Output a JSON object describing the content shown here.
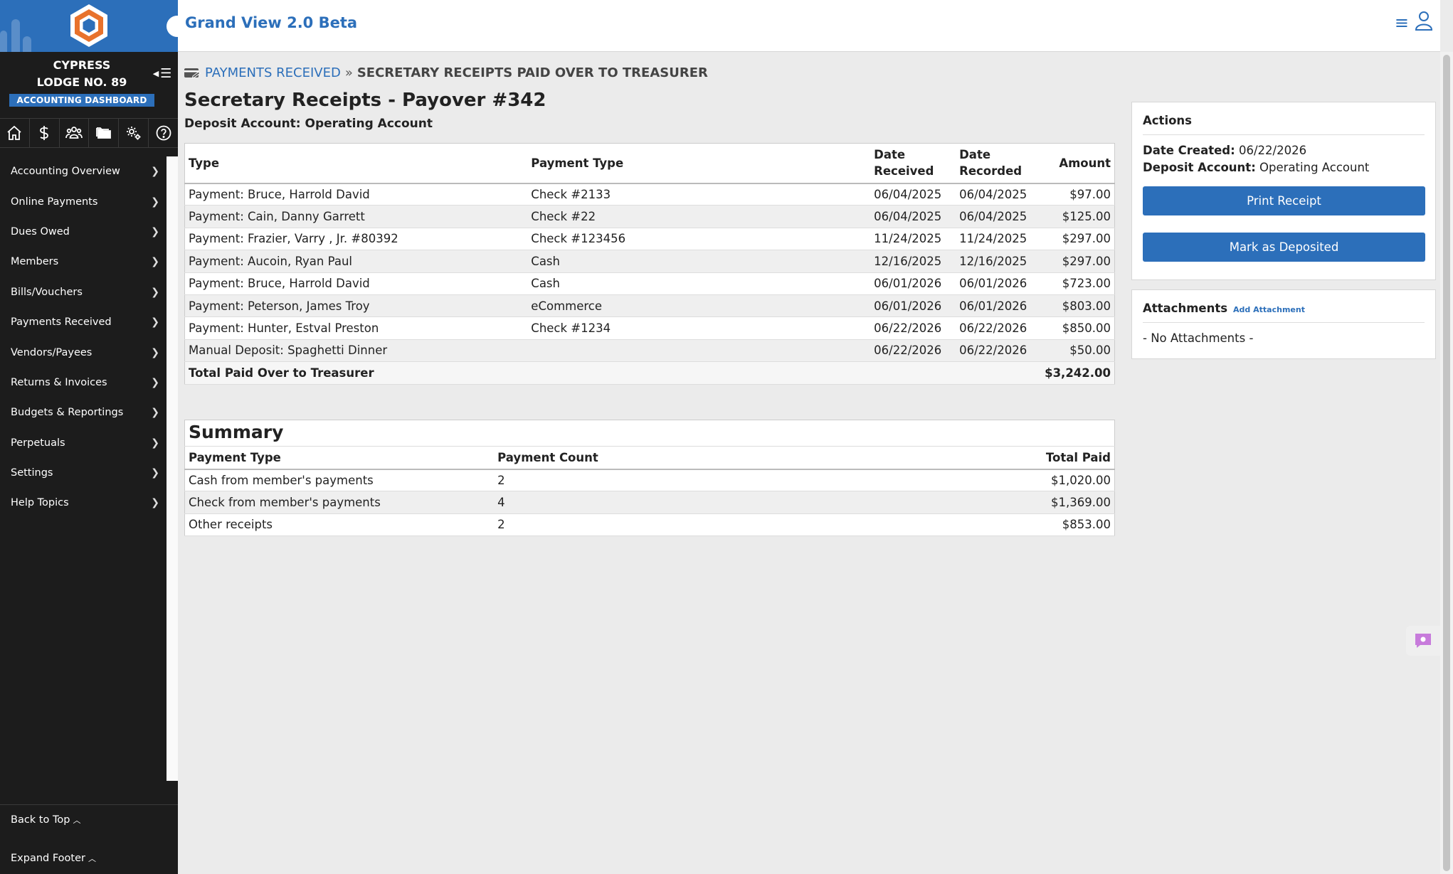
{
  "sidebar": {
    "lodge_name": "CYPRESS\nLODGE NO. 89",
    "dashboard_badge": "ACCOUNTING DASHBOARD",
    "icon_bar": [
      "home-icon",
      "dollar-icon",
      "members-icon",
      "folders-icon",
      "settings-icon",
      "help-icon"
    ],
    "items": [
      {
        "label": "Accounting Overview"
      },
      {
        "label": "Online Payments"
      },
      {
        "label": "Dues Owed"
      },
      {
        "label": "Members"
      },
      {
        "label": "Bills/Vouchers"
      },
      {
        "label": "Payments Received"
      },
      {
        "label": "Vendors/Payees"
      },
      {
        "label": "Returns & Invoices"
      },
      {
        "label": "Budgets & Reportings"
      },
      {
        "label": "Perpetuals"
      },
      {
        "label": "Settings"
      },
      {
        "label": "Help Topics"
      }
    ],
    "footer": {
      "back_to_top": "Back to Top",
      "expand_footer": "Expand Footer"
    }
  },
  "header": {
    "app_title": "Grand View 2.0 Beta"
  },
  "breadcrumb": {
    "link": "PAYMENTS RECEIVED",
    "separator": "»",
    "current": "SECRETARY RECEIPTS PAID OVER TO TREASURER"
  },
  "main": {
    "title": "Secretary Receipts - Payover #342",
    "deposit_account": "Deposit Account: Operating Account",
    "payments": {
      "headers": {
        "type": "Type",
        "payment_type": "Payment Type",
        "date_received": "Date Received",
        "date_recorded": "Date Recorded",
        "amount": "Amount"
      },
      "rows": [
        {
          "type": "Payment: Bruce, Harrold David",
          "payment_type": "Check #2133",
          "date_received": "06/04/2025",
          "date_recorded": "06/04/2025",
          "amount": "$97.00"
        },
        {
          "type": "Payment: Cain, Danny Garrett",
          "payment_type": "Check #22",
          "date_received": "06/04/2025",
          "date_recorded": "06/04/2025",
          "amount": "$125.00"
        },
        {
          "type": "Payment: Frazier, Varry , Jr. #80392",
          "payment_type": "Check #123456",
          "date_received": "11/24/2025",
          "date_recorded": "11/24/2025",
          "amount": "$297.00"
        },
        {
          "type": "Payment: Aucoin, Ryan Paul",
          "payment_type": "Cash",
          "date_received": "12/16/2025",
          "date_recorded": "12/16/2025",
          "amount": "$297.00"
        },
        {
          "type": "Payment: Bruce, Harrold David",
          "payment_type": "Cash",
          "date_received": "06/01/2026",
          "date_recorded": "06/01/2026",
          "amount": "$723.00"
        },
        {
          "type": "Payment: Peterson, James Troy",
          "payment_type": "eCommerce",
          "date_received": "06/01/2026",
          "date_recorded": "06/01/2026",
          "amount": "$803.00"
        },
        {
          "type": "Payment: Hunter, Estval Preston",
          "payment_type": "Check #1234",
          "date_received": "06/22/2026",
          "date_recorded": "06/22/2026",
          "amount": "$850.00"
        },
        {
          "type": "Manual Deposit: Spaghetti Dinner",
          "payment_type": "",
          "date_received": "06/22/2026",
          "date_recorded": "06/22/2026",
          "amount": "$50.00"
        }
      ],
      "total_label": "Total Paid Over to Treasurer",
      "total_amount": "$3,242.00"
    },
    "summary": {
      "title": "Summary",
      "headers": {
        "payment_type": "Payment Type",
        "payment_count": "Payment Count",
        "total_paid": "Total Paid"
      },
      "rows": [
        {
          "payment_type": "Cash from member's payments",
          "payment_count": "2",
          "total_paid": "$1,020.00"
        },
        {
          "payment_type": "Check from member's payments",
          "payment_count": "4",
          "total_paid": "$1,369.00"
        },
        {
          "payment_type": "Other receipts",
          "payment_count": "2",
          "total_paid": "$853.00"
        }
      ]
    }
  },
  "actions": {
    "title": "Actions",
    "date_created_label": "Date Created:",
    "date_created": "06/22/2026",
    "deposit_account_label": "Deposit Account:",
    "deposit_account": "Operating Account",
    "print_receipt": "Print Receipt",
    "mark_deposited": "Mark as Deposited"
  },
  "attachments": {
    "title": "Attachments",
    "add_link": "Add Attachment",
    "empty_text": "- No Attachments -"
  },
  "colors": {
    "brand_blue": "#2c6fba",
    "sidebar_bg": "#1c1c1c",
    "logo_orange": "#e8722c"
  }
}
